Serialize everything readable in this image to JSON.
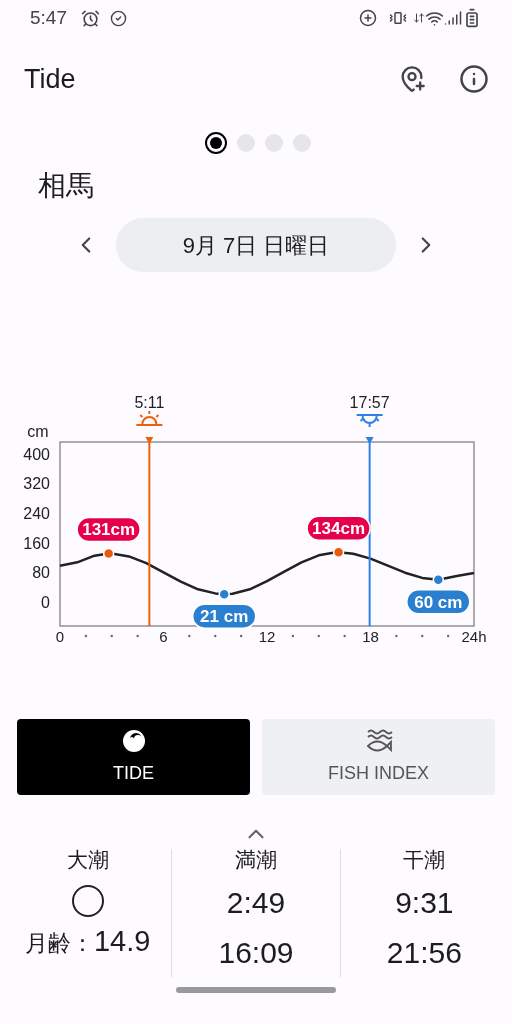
{
  "status_bar": {
    "time": "5:47"
  },
  "app_bar": {
    "title": "Tide"
  },
  "page_dots": [
    {
      "selected": true
    },
    {
      "selected": false
    },
    {
      "selected": false
    },
    {
      "selected": false
    }
  ],
  "location": "相馬",
  "date_nav": {
    "date": "9月 7日 日曜日"
  },
  "tide_chart": {
    "chart_data": {
      "type": "line",
      "ylabel": "cm",
      "x": [
        0,
        1,
        2,
        2.82,
        3,
        4,
        5,
        6,
        7,
        8,
        9,
        9.52,
        10,
        11,
        12,
        13,
        14,
        15,
        16,
        16.15,
        17,
        18,
        19,
        20,
        21,
        21.93,
        23,
        24
      ],
      "series": [
        {
          "color": "#222222",
          "values": [
            98,
            107,
            125,
            131,
            131,
            123,
            105,
            80,
            55,
            34,
            23,
            21,
            22,
            34,
            56,
            82,
            107,
            126,
            134,
            134,
            130,
            117,
            98,
            79,
            65,
            60,
            70,
            78
          ]
        }
      ],
      "xlim": [
        0,
        24
      ],
      "ylim": [
        -65,
        432
      ],
      "xticks": [
        0,
        6,
        12,
        18,
        {
          "value": 24,
          "label": "24h"
        }
      ],
      "yticks": [
        0,
        80,
        160,
        240,
        320,
        400
      ],
      "ref_lines": [
        {
          "axis": "x",
          "value": 5.18,
          "color": "#ee5f0c"
        },
        {
          "axis": "x",
          "value": 17.95,
          "color": "#2f7fe6"
        }
      ],
      "annotations": [
        {
          "text": "131cm",
          "x": 2.82,
          "y": 131
        },
        {
          "text": "21 cm",
          "x": 9.52,
          "y": 21
        },
        {
          "text": "134cm",
          "x": 16.15,
          "y": 134
        },
        {
          "text": "60 cm",
          "x": 21.93,
          "y": 60
        }
      ]
    },
    "sun_events": [
      {
        "kind": "sunrise",
        "time": "5:11"
      },
      {
        "kind": "sunset",
        "time": "17:57"
      }
    ]
  },
  "tabs": [
    {
      "kind": "tide",
      "label": "TIDE",
      "selected": true
    },
    {
      "kind": "fish",
      "label": "FISH INDEX",
      "selected": false
    }
  ],
  "summary": [
    {
      "kind": "moon",
      "title": "大潮",
      "moon_age_label": "月齢：",
      "moon_age": "14.9"
    },
    {
      "kind": "times",
      "title": "満潮",
      "times": [
        "2:49",
        "16:09"
      ]
    },
    {
      "kind": "times",
      "title": "干潮",
      "times": [
        "9:31",
        "21:56"
      ]
    }
  ]
}
